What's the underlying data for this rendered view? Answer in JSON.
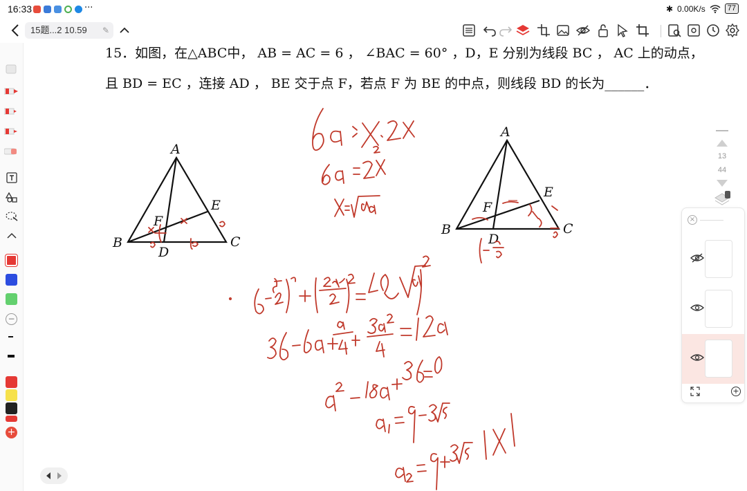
{
  "status_bar": {
    "time": "16:33",
    "dots": "···",
    "net_speed": "0.00K/s",
    "battery": "77"
  },
  "toolbar": {
    "document_title": "15题...2 10.59"
  },
  "question": {
    "line1": "15．如图，在△ABC中， AB = AC = 6 ， ∠BAC = 60° ，D，E 分别为线段 BC ， AC 上的动点，",
    "line2": "且 BD = EC ，连接 AD ， BE 交于点 F，若点 F 为 BE 的中点，则线段 BD 的长为______．"
  },
  "figure_left": {
    "A": "A",
    "B": "B",
    "C": "C",
    "D": "D",
    "E": "E",
    "F": "F"
  },
  "figure_right": {
    "A": "A",
    "B": "B",
    "C": "C",
    "D": "D",
    "E": "E",
    "F": "F"
  },
  "pager": {
    "current": "13",
    "total": "44"
  },
  "colors": {
    "ink_red": "#c0392b",
    "accent_red": "#e53935",
    "layer_active_bg": "#fbe6e2"
  },
  "rail_colors": [
    "#e53935",
    "#2c4de0",
    "#63d06e",
    "#e53935",
    "#f6e14b",
    "#222222",
    "#e53935"
  ]
}
